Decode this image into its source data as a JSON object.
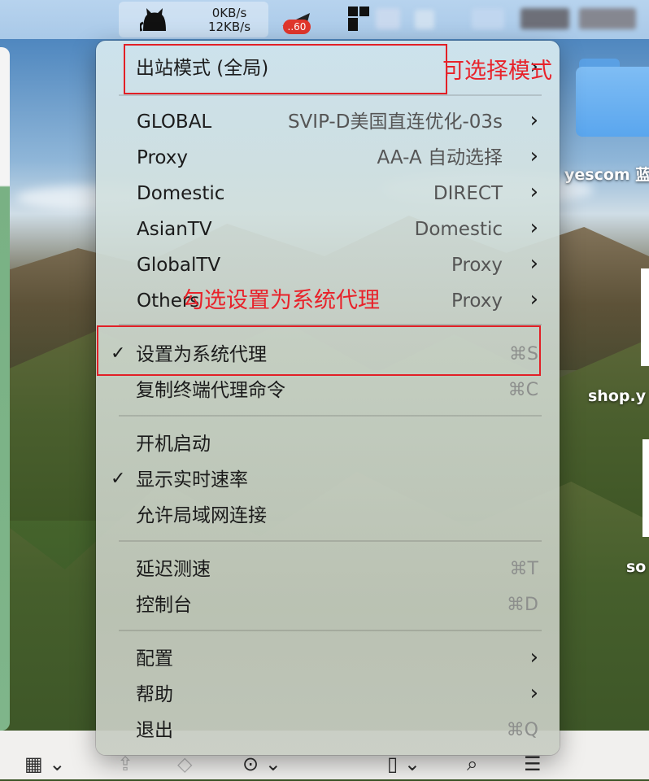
{
  "menubar": {
    "speed_up": "0KB/s",
    "speed_down": "12KB/s",
    "badge": "..60"
  },
  "desktop": {
    "label_yescom": "yescom 蓝",
    "label_shop": "shop.y",
    "label_so": "so"
  },
  "menu": {
    "mode_title": "出站模式 (全局)",
    "groups": [
      {
        "label": "GLOBAL",
        "value": "SVIP-D美国直连优化-03s"
      },
      {
        "label": "Proxy",
        "value": "AA-A 自动选择"
      },
      {
        "label": "Domestic",
        "value": "DIRECT"
      },
      {
        "label": "AsianTV",
        "value": "Domestic"
      },
      {
        "label": "GlobalTV",
        "value": "Proxy"
      },
      {
        "label": "Others",
        "value": "Proxy"
      }
    ],
    "system_proxy": {
      "label": "设置为系统代理",
      "shortcut": "⌘S",
      "checked": true
    },
    "copy_command": {
      "label": "复制终端代理命令",
      "shortcut": "⌘C"
    },
    "start_at_login": {
      "label": "开机启动",
      "checked": false
    },
    "show_speed": {
      "label": "显示实时速率",
      "checked": true
    },
    "allow_lan": {
      "label": "允许局域网连接",
      "checked": false
    },
    "latency_test": {
      "label": "延迟测速",
      "shortcut": "⌘T"
    },
    "dashboard": {
      "label": "控制台",
      "shortcut": "⌘D"
    },
    "config": {
      "label": "配置"
    },
    "help": {
      "label": "帮助"
    },
    "quit": {
      "label": "退出",
      "shortcut": "⌘Q"
    }
  },
  "annotations": {
    "mode_note": "可选择模式",
    "proxy_note": "勾选设置为系统代理"
  },
  "colors": {
    "annotation_red": "#e21f26",
    "menu_text": "#1b1b1b",
    "shortcut_gray": "#8d8f8d"
  },
  "icons": {
    "menubar": [
      "cat-icon",
      "paper-plane-icon",
      "grid-icon"
    ],
    "toolbar": [
      "view-grid-icon",
      "share-icon",
      "tag-icon",
      "more-icon",
      "device-icon",
      "search-icon",
      "list-icon"
    ]
  }
}
